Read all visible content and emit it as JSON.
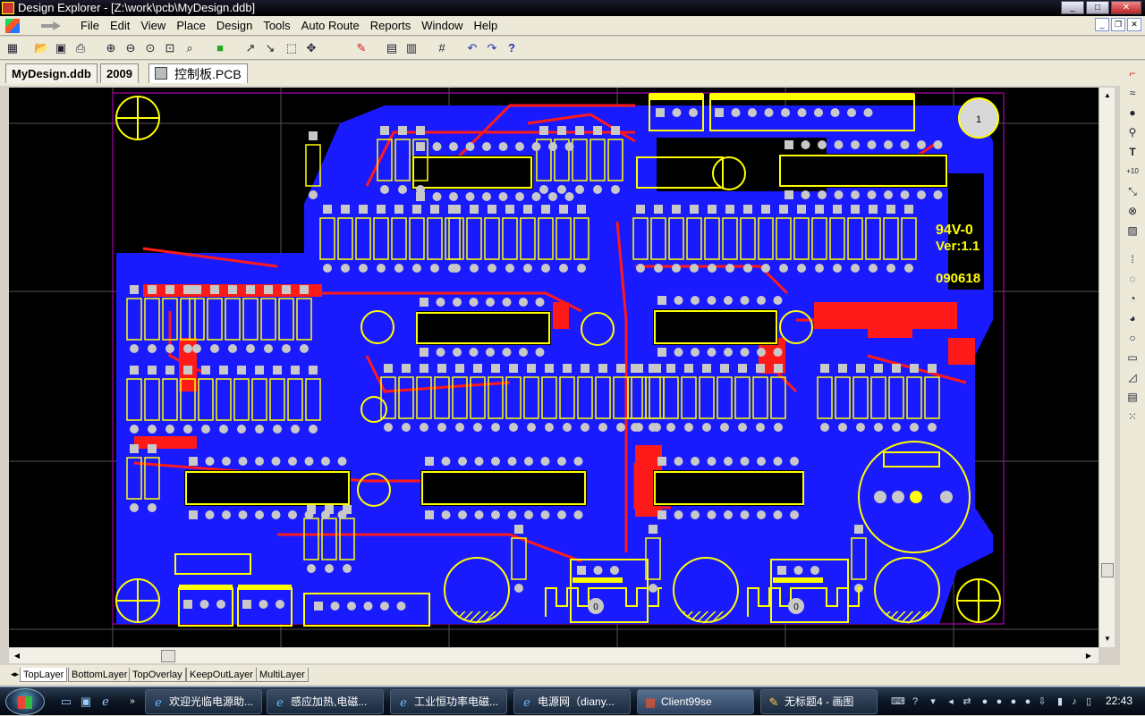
{
  "window": {
    "title": "Design Explorer - [Z:\\work\\pcb\\MyDesign.ddb]"
  },
  "menu": [
    "File",
    "Edit",
    "View",
    "Place",
    "Design",
    "Tools",
    "Auto Route",
    "Reports",
    "Window",
    "Help"
  ],
  "toolbar": {
    "icons": [
      "design-manager-icon",
      "open-icon",
      "save-icon",
      "print-icon",
      "zoom-in-icon",
      "zoom-out-icon",
      "zoom-fit-icon",
      "zoom-area-icon",
      "browse-icon",
      "cross-probe-icon",
      "select-icon",
      "deselect-icon",
      "move-icon",
      "ruler-icon",
      "library-icon",
      "library-browse-icon",
      "grid-icon",
      "undo-icon",
      "redo-icon",
      "help-icon"
    ]
  },
  "doc_tabs": [
    "MyDesign.ddb",
    "2009",
    "控制板.PCB"
  ],
  "board": {
    "text_1": "94V-0",
    "text_2": "Ver:1.1",
    "text_3": "090618",
    "fiducial_label": "1",
    "bottom_label_1": "0",
    "bottom_label_2": "0"
  },
  "layer_tabs": [
    "TopLayer",
    "BottomLayer",
    "TopOverlay",
    "KeepOutLayer",
    "MultiLayer"
  ],
  "taskbar": {
    "tasks": [
      "欢迎光临电源助...",
      "感应加热,电磁...",
      "工业恒功率电磁...",
      "电源网（diany...",
      "Client99se",
      "无标题4 - 画图"
    ],
    "clock": "22:43"
  },
  "colors": {
    "bottom_copper": "#1a1aff",
    "top_copper": "#ff1a1a",
    "overlay": "#ffff00",
    "pad": "#c8c8c8",
    "background": "#000000"
  }
}
